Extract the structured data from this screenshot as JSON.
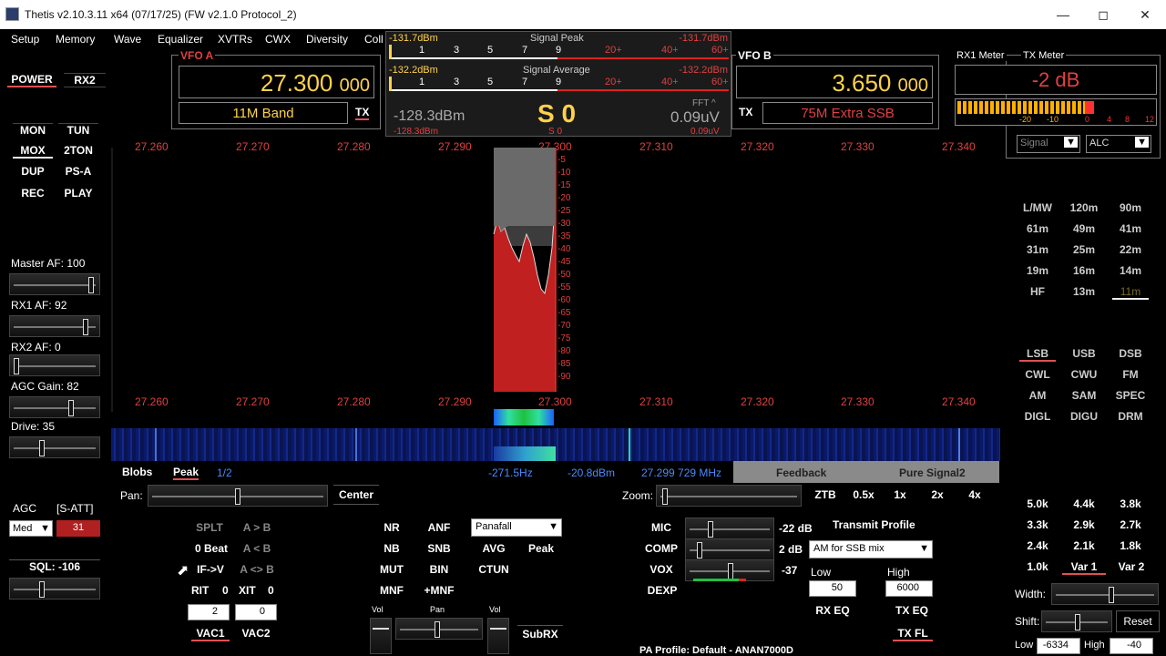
{
  "window": {
    "title": "Thetis v2.10.3.11 x64 (07/17/25) (FW v2.1.0 Protocol_2)"
  },
  "menu": [
    "Setup",
    "Memory",
    "Wave",
    "Equalizer",
    "XVTRs",
    "CWX",
    "Diversity",
    "Coll"
  ],
  "left": {
    "power": "POWER",
    "rx2": "RX2",
    "mon": "MON",
    "tun": "TUN",
    "mox": "MOX",
    "twoton": "2TON",
    "dup": "DUP",
    "psa": "PS-A",
    "rec": "REC",
    "play": "PLAY",
    "master_af": "Master AF:  100",
    "rx1_af": "RX1 AF:  92",
    "rx2_af": "RX2 AF:  0",
    "agc_gain": "AGC Gain:  82",
    "drive": "Drive:  35",
    "agc_label": "AGC",
    "satt_label": "[S-ATT]",
    "agc_value": "Med",
    "satt_value": "31",
    "sql": "SQL:  -106"
  },
  "vfo_a": {
    "label": "VFO A",
    "freq_main": "27.300",
    "freq_small": "000",
    "band": "11M Band",
    "tx": "TX"
  },
  "vfo_b": {
    "label": "VFO B",
    "freq_main": "3.650",
    "freq_small": "000",
    "band": "75M Extra SSB",
    "tx": "TX"
  },
  "meters": {
    "peak_left": "-131.7dBm",
    "peak_title": "Signal Peak",
    "peak_right": "-131.7dBm",
    "avg_left": "-132.2dBm",
    "avg_title": "Signal Average",
    "avg_right": "-132.2dBm",
    "scale": [
      "1",
      "3",
      "5",
      "7",
      "9",
      "20+",
      "40+",
      "60+"
    ],
    "dbm": "-128.3dBm",
    "s_value": "S 0",
    "fft": "FFT",
    "uv": "0.09uV",
    "dbm_small": "-128.3dBm",
    "s_small": "S 0",
    "uv_small": "0.09uV"
  },
  "rx1_meter": {
    "title": "RX1 Meter",
    "value": "-2 dB",
    "scale": [
      "-20",
      "-10",
      "0",
      "4",
      "8",
      "12"
    ]
  },
  "tx_meter": {
    "title": "TX Meter",
    "sel1": "Signal",
    "sel2": "ALC"
  },
  "spectrum": {
    "freqs": [
      "27.260",
      "27.270",
      "27.280",
      "27.290",
      "27.300",
      "27.310",
      "27.320",
      "27.330",
      "27.340"
    ],
    "db": [
      "-5",
      "-10",
      "-15",
      "-20",
      "-25",
      "-30",
      "-35",
      "-40",
      "-45",
      "-50",
      "-55",
      "-60",
      "-65",
      "-70",
      "-75",
      "-80",
      "-85",
      "-90"
    ]
  },
  "bands": [
    "L/MW",
    "120m",
    "90m",
    "61m",
    "49m",
    "41m",
    "31m",
    "25m",
    "22m",
    "19m",
    "16m",
    "14m",
    "HF",
    "13m",
    "11m"
  ],
  "modes": [
    "LSB",
    "USB",
    "DSB",
    "CWL",
    "CWU",
    "FM",
    "AM",
    "SAM",
    "SPEC",
    "DIGL",
    "DIGU",
    "DRM"
  ],
  "filters": [
    "5.0k",
    "4.4k",
    "3.8k",
    "3.3k",
    "2.9k",
    "2.7k",
    "2.4k",
    "2.1k",
    "1.8k",
    "1.0k",
    "Var 1",
    "Var 2"
  ],
  "right_bottom": {
    "width": "Width:",
    "shift": "Shift:",
    "reset": "Reset",
    "low_label": "Low",
    "low_value": "-6334",
    "high_label": "High",
    "high_value": "-40"
  },
  "display_bar": {
    "blobs": "Blobs",
    "peak": "Peak",
    "page": "1/2",
    "hz": "-271.5Hz",
    "dbm": "-20.8dBm",
    "mhz": "27.299 729 MHz",
    "feedback": "Feedback",
    "pure_signal": "Pure Signal2",
    "pan": "Pan:",
    "center": "Center",
    "zoom": "Zoom:",
    "ztb": "ZTB",
    "z05": "0.5x",
    "z1": "1x",
    "z2": "2x",
    "z4": "4x"
  },
  "vfo_ctrl": {
    "splt": "SPLT",
    "a_to_b": "A > B",
    "zero_beat": "0 Beat",
    "a_from_b": "A < B",
    "if_v": "IF->V",
    "a_swap_b": "A <> B",
    "rit": "RIT",
    "rit_val": "0",
    "xit": "XIT",
    "xit_val": "0",
    "rit_step": "2",
    "xit_step": "0",
    "vac1": "VAC1",
    "vac2": "VAC2"
  },
  "dsp": {
    "nr": "NR",
    "anf": "ANF",
    "nb": "NB",
    "snb": "SNB",
    "mut": "MUT",
    "bin": "BIN",
    "mnf": "MNF",
    "plus_mnf": "+MNF",
    "panafall": "Panafall",
    "avg": "AVG",
    "peak": "Peak",
    "ctun": "CTUN",
    "vol": "Vol",
    "pan": "Pan",
    "vol2": "Vol",
    "subrx": "SubRX"
  },
  "tx": {
    "mic": "MIC",
    "mic_val": "-22 dB",
    "comp": "COMP",
    "comp_val": "2 dB",
    "vox": "VOX",
    "vox_val": "-37",
    "dexp": "DEXP",
    "profile_title": "Transmit Profile",
    "profile": "AM for SSB mix",
    "low": "Low",
    "low_val": "50",
    "high": "High",
    "high_val": "6000",
    "rx_eq": "RX EQ",
    "tx_eq": "TX EQ",
    "tx_fl": "TX FL",
    "pa_profile": "PA Profile: Default - ANAN7000D"
  }
}
